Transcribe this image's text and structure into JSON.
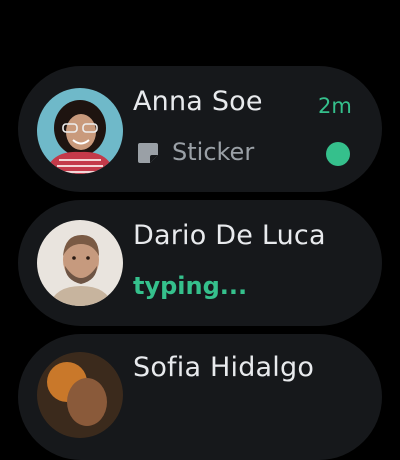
{
  "chats": [
    {
      "name": "Anna Soe",
      "time": "2m",
      "preview_icon": "sticker-icon",
      "preview": "Sticker",
      "unread": true
    },
    {
      "name": "Dario De Luca",
      "status": "typing..."
    },
    {
      "name": "Sofia Hidalgo"
    }
  ],
  "colors": {
    "background": "#000000",
    "card": "#16181b",
    "accent": "#35c08c",
    "text_primary": "#e8eaed",
    "text_secondary": "#9aa0a6"
  }
}
